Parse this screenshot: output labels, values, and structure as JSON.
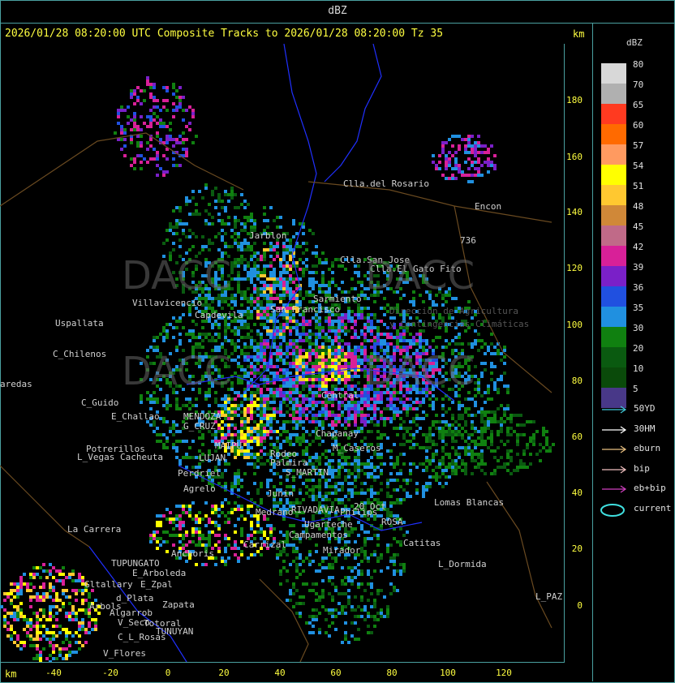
{
  "header": {
    "unit_label": "dBZ"
  },
  "title": "2026/01/28 08:20:00 UTC Composite Tracks to 2026/01/28 08:20:00 Tz 35",
  "km_top": "km",
  "km_bottom": "km",
  "y_ticks": [
    "180",
    "160",
    "140",
    "120",
    "100",
    "80",
    "60",
    "40",
    "20",
    "0"
  ],
  "x_ticks": [
    "-40",
    "-20",
    "0",
    "20",
    "40",
    "60",
    "80",
    "100",
    "120"
  ],
  "legend": {
    "title": "dBZ",
    "levels": [
      {
        "label": "80",
        "color": "#d8d8d8"
      },
      {
        "label": "70",
        "color": "#b0b0b0"
      },
      {
        "label": "65",
        "color": "#ff3a20"
      },
      {
        "label": "60",
        "color": "#ff6a00"
      },
      {
        "label": "57",
        "color": "#ff9a60"
      },
      {
        "label": "54",
        "color": "#ffff00"
      },
      {
        "label": "51",
        "color": "#ffc830"
      },
      {
        "label": "48",
        "color": "#d08838"
      },
      {
        "label": "45",
        "color": "#c06a88"
      },
      {
        "label": "42",
        "color": "#d82098"
      },
      {
        "label": "39",
        "color": "#7a20c8"
      },
      {
        "label": "36",
        "color": "#2050e0"
      },
      {
        "label": "35",
        "color": "#2090e0"
      },
      {
        "label": "30",
        "color": "#108010"
      },
      {
        "label": "20",
        "color": "#0a5a10"
      },
      {
        "label": "10",
        "color": "#0a4a0a"
      },
      {
        "label": "5",
        "color": "#483888"
      }
    ],
    "tracks": [
      {
        "label": "50YD",
        "color": "#40c8d8"
      },
      {
        "label": "30HM",
        "color": "#ffffff"
      },
      {
        "label": "eburn",
        "color": "#e8c080"
      },
      {
        "label": "bip",
        "color": "#f0c0c0"
      },
      {
        "label": "eb+bip",
        "color": "#d040c0"
      },
      {
        "label": "current",
        "color": "#40e0e0"
      }
    ]
  },
  "places": [
    {
      "name": "Clla.del Rosario"
    },
    {
      "name": "Encon"
    },
    {
      "name": "Jarblon"
    },
    {
      "name": "Clla.San Jose"
    },
    {
      "name": "Clla.El Gato Fito"
    },
    {
      "name": "Villavicencio"
    },
    {
      "name": "Capdevila"
    },
    {
      "name": "San Francisco"
    },
    {
      "name": "Sarmiento"
    },
    {
      "name": "Uspallata"
    },
    {
      "name": "C_Chilenos"
    },
    {
      "name": "aredas"
    },
    {
      "name": "C_Guido"
    },
    {
      "name": "E_Challao"
    },
    {
      "name": "MENDOZA"
    },
    {
      "name": "G_CRUZ"
    },
    {
      "name": "Potrerillos"
    },
    {
      "name": "L_Vegas"
    },
    {
      "name": "Cacheuta"
    },
    {
      "name": "LUJAN"
    },
    {
      "name": "Perdriel"
    },
    {
      "name": "Agrelo"
    },
    {
      "name": "MAIPU"
    },
    {
      "name": "Rodeo"
    },
    {
      "name": "Palmira"
    },
    {
      "name": "S_MARTIN"
    },
    {
      "name": "Chapanay"
    },
    {
      "name": "M_Caseros"
    },
    {
      "name": "Central"
    },
    {
      "name": "Junin"
    },
    {
      "name": "Philips"
    },
    {
      "name": "Medrano"
    },
    {
      "name": "RIVADAVIA"
    },
    {
      "name": "20 Oct"
    },
    {
      "name": "ROSA"
    },
    {
      "name": "Lomas Blancas"
    },
    {
      "name": "Catitas"
    },
    {
      "name": "L_Dormida"
    },
    {
      "name": "L_PAZ"
    },
    {
      "name": "Mirador"
    },
    {
      "name": "Campamentos"
    },
    {
      "name": "Ugarteche"
    },
    {
      "name": "Carrizal"
    },
    {
      "name": "La Carrera"
    },
    {
      "name": "Anchoris"
    },
    {
      "name": "TUPUNGATO"
    },
    {
      "name": "E_Zpal"
    },
    {
      "name": "E_Arboleda"
    },
    {
      "name": "Gltallary"
    },
    {
      "name": "d_Plata"
    },
    {
      "name": "Arbols"
    },
    {
      "name": "Algarrob"
    },
    {
      "name": "V_Seco"
    },
    {
      "name": "Zapata"
    },
    {
      "name": "TUNUYAN"
    },
    {
      "name": "Totoral"
    },
    {
      "name": "C_L_Rosas"
    },
    {
      "name": "V_Flores"
    },
    {
      "name": "736"
    }
  ],
  "watermarks": [
    "DACC",
    "DACC",
    "DACC",
    "DACC"
  ],
  "watermark_sub": [
    "Dirección de Agricultura",
    "y Contingencias Climáticas"
  ]
}
